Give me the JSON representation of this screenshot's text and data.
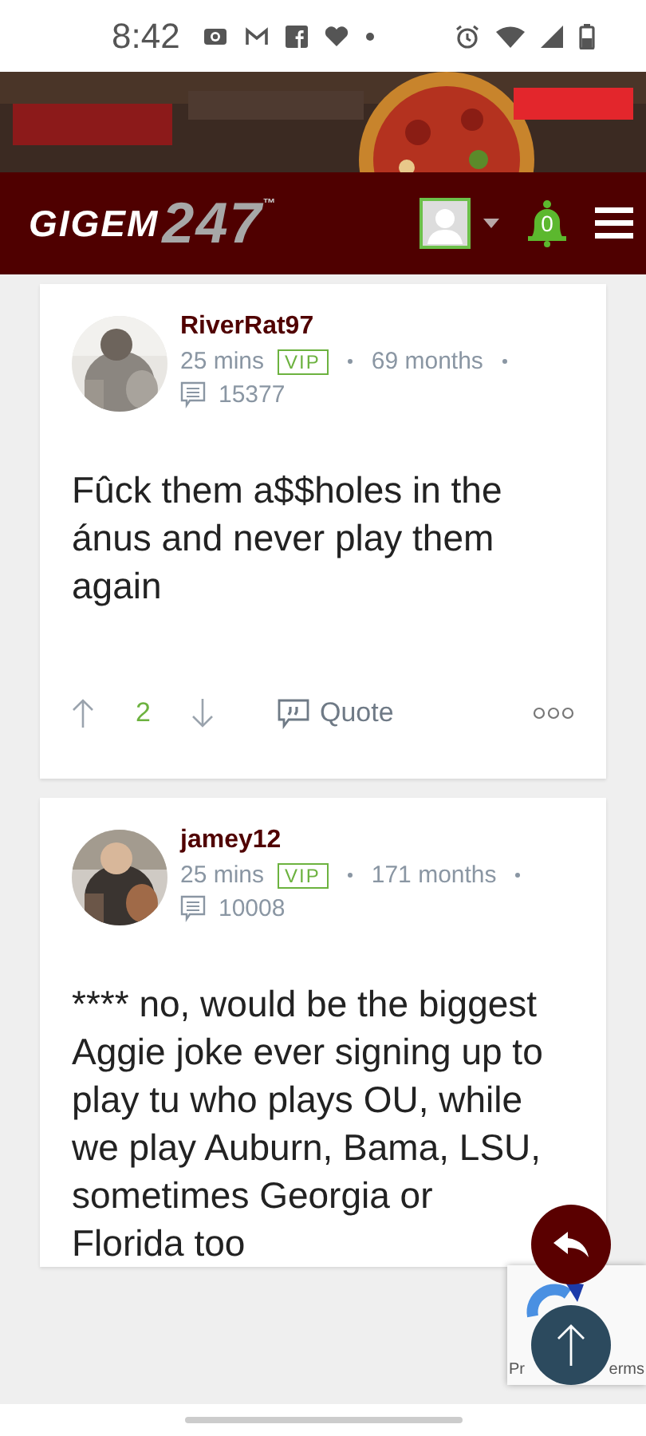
{
  "status_bar": {
    "time": "8:42"
  },
  "header": {
    "logo_main": "GIGEM",
    "logo_number": "247",
    "logo_mark": "™",
    "notification_count": "0"
  },
  "posts": [
    {
      "author": "RiverRat97",
      "time": "25 mins",
      "badge": "VIP",
      "tenure": "69 months",
      "post_count": "15377",
      "body": "Fûck them a$$holes in the ánus and never play them again",
      "footer": {
        "votes": "2",
        "quote": "Quote"
      }
    },
    {
      "author": "jamey12",
      "time": "25 mins",
      "badge": "VIP",
      "tenure": "171 months",
      "post_count": "10008",
      "body": "**** no, would be the biggest Aggie joke ever signing up to play tu who plays OU, while we play Auburn, Bama, LSU, sometimes Georgia or Florida too"
    }
  ],
  "recaptcha": {
    "left_text": "Pr",
    "right_text": "erms"
  }
}
